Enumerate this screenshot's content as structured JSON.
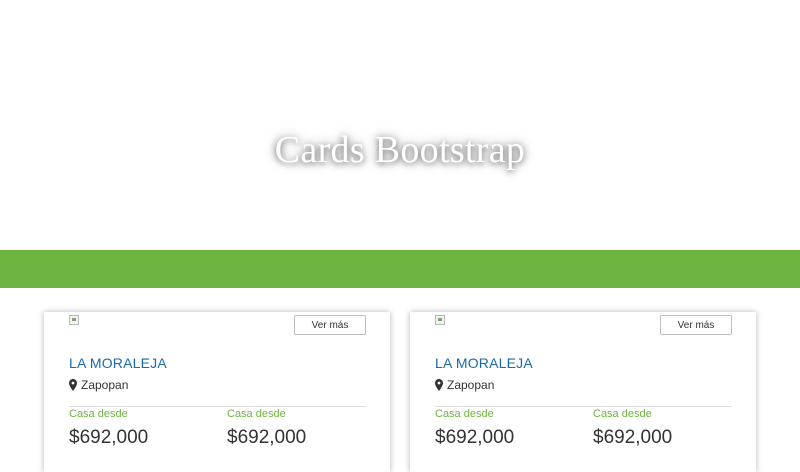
{
  "hero": {
    "title": "Cards Bootstrap"
  },
  "colors": {
    "accent_green": "#6db33f",
    "title_blue": "#1d68a7"
  },
  "cards": [
    {
      "button_label": "Ver más",
      "title": "LA MORALEJA",
      "location": "Zapopan",
      "location_icon": "map-pin-icon",
      "prices": [
        {
          "label": "Casa desde",
          "value": "$692,000"
        },
        {
          "label": "Casa desde",
          "value": "$692,000"
        }
      ]
    },
    {
      "button_label": "Ver más",
      "title": "LA MORALEJA",
      "location": "Zapopan",
      "location_icon": "map-pin-icon",
      "prices": [
        {
          "label": "Casa desde",
          "value": "$692,000"
        },
        {
          "label": "Casa desde",
          "value": "$692,000"
        }
      ]
    }
  ]
}
